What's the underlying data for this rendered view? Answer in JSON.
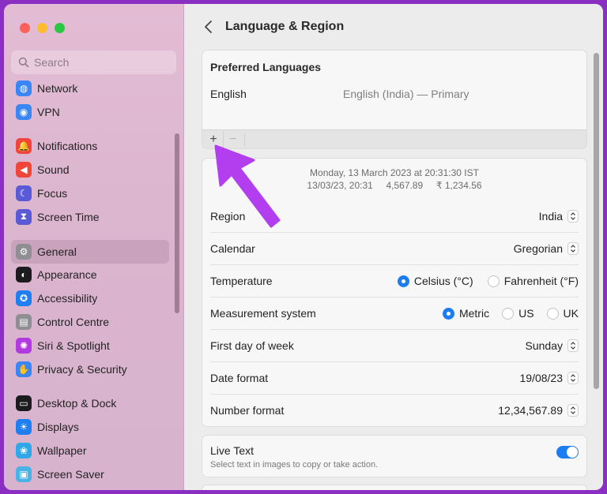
{
  "window": {
    "traffic": [
      "close",
      "minimize",
      "zoom"
    ]
  },
  "sidebar": {
    "search_placeholder": "Search",
    "groups": [
      [
        {
          "label": "Network",
          "icon": "network-icon",
          "color": "#3a86f5"
        },
        {
          "label": "VPN",
          "icon": "vpn-icon",
          "color": "#3a86f5"
        }
      ],
      [
        {
          "label": "Notifications",
          "icon": "bell-icon",
          "color": "#f0453b"
        },
        {
          "label": "Sound",
          "icon": "speaker-icon",
          "color": "#f0453b"
        },
        {
          "label": "Focus",
          "icon": "moon-icon",
          "color": "#5b5ad6"
        },
        {
          "label": "Screen Time",
          "icon": "hourglass-icon",
          "color": "#5b5ad6"
        }
      ],
      [
        {
          "label": "General",
          "icon": "gear-icon",
          "color": "#8e8e93",
          "active": true
        },
        {
          "label": "Appearance",
          "icon": "appearance-icon",
          "color": "#1c1c1e"
        },
        {
          "label": "Accessibility",
          "icon": "accessibility-icon",
          "color": "#1f7ff0"
        },
        {
          "label": "Control Centre",
          "icon": "control-centre-icon",
          "color": "#8e8e93"
        },
        {
          "label": "Siri & Spotlight",
          "icon": "siri-icon",
          "color": "#b03ae0"
        },
        {
          "label": "Privacy & Security",
          "icon": "hand-icon",
          "color": "#3a86f5"
        }
      ],
      [
        {
          "label": "Desktop & Dock",
          "icon": "dock-icon",
          "color": "#1c1c1e"
        },
        {
          "label": "Displays",
          "icon": "sun-icon",
          "color": "#1f7ff0"
        },
        {
          "label": "Wallpaper",
          "icon": "flower-icon",
          "color": "#2fa7e8"
        },
        {
          "label": "Screen Saver",
          "icon": "screensaver-icon",
          "color": "#49b2e6"
        }
      ]
    ]
  },
  "header": {
    "title": "Language & Region"
  },
  "preferred": {
    "title": "Preferred Languages",
    "language": "English",
    "detail": "English (India) — Primary",
    "add": "+",
    "remove": "−"
  },
  "preview": {
    "line1": "Monday, 13 March 2023 at 20:31:30 IST",
    "line2": "13/03/23, 20:31     4,567.89     ₹ 1,234.56"
  },
  "settings": {
    "region": {
      "label": "Region",
      "value": "India"
    },
    "calendar": {
      "label": "Calendar",
      "value": "Gregorian"
    },
    "temperature": {
      "label": "Temperature",
      "options": [
        "Celsius (°C)",
        "Fahrenheit (°F)"
      ],
      "selected": 0
    },
    "measurement": {
      "label": "Measurement system",
      "options": [
        "Metric",
        "US",
        "UK"
      ],
      "selected": 0
    },
    "first_day": {
      "label": "First day of week",
      "value": "Sunday"
    },
    "date_format": {
      "label": "Date format",
      "value": "19/08/23"
    },
    "number_format": {
      "label": "Number format",
      "value": "12,34,567.89"
    }
  },
  "live_text": {
    "title": "Live Text",
    "subtitle": "Select text in images to copy or take action.",
    "enabled": true
  },
  "colors": {
    "accent": "#1e7cf2",
    "annotation_arrow": "#b23ef0"
  }
}
